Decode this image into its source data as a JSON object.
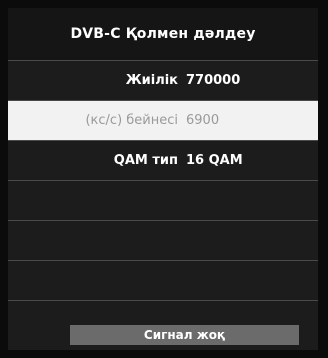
{
  "title": "DVB-C Қолмен дәлдеу",
  "fields": [
    {
      "label": "Жиілік",
      "value": "770000"
    },
    {
      "label": "(кс/с) бейнесі",
      "value": "6900"
    },
    {
      "label": "QAM тип",
      "value": "16 QAM"
    }
  ],
  "status": "Сигнал жоқ",
  "colors": {
    "background": "#1c1c1c",
    "selected_row": "#f2f2f2",
    "status_bar": "#6b6b6b"
  }
}
